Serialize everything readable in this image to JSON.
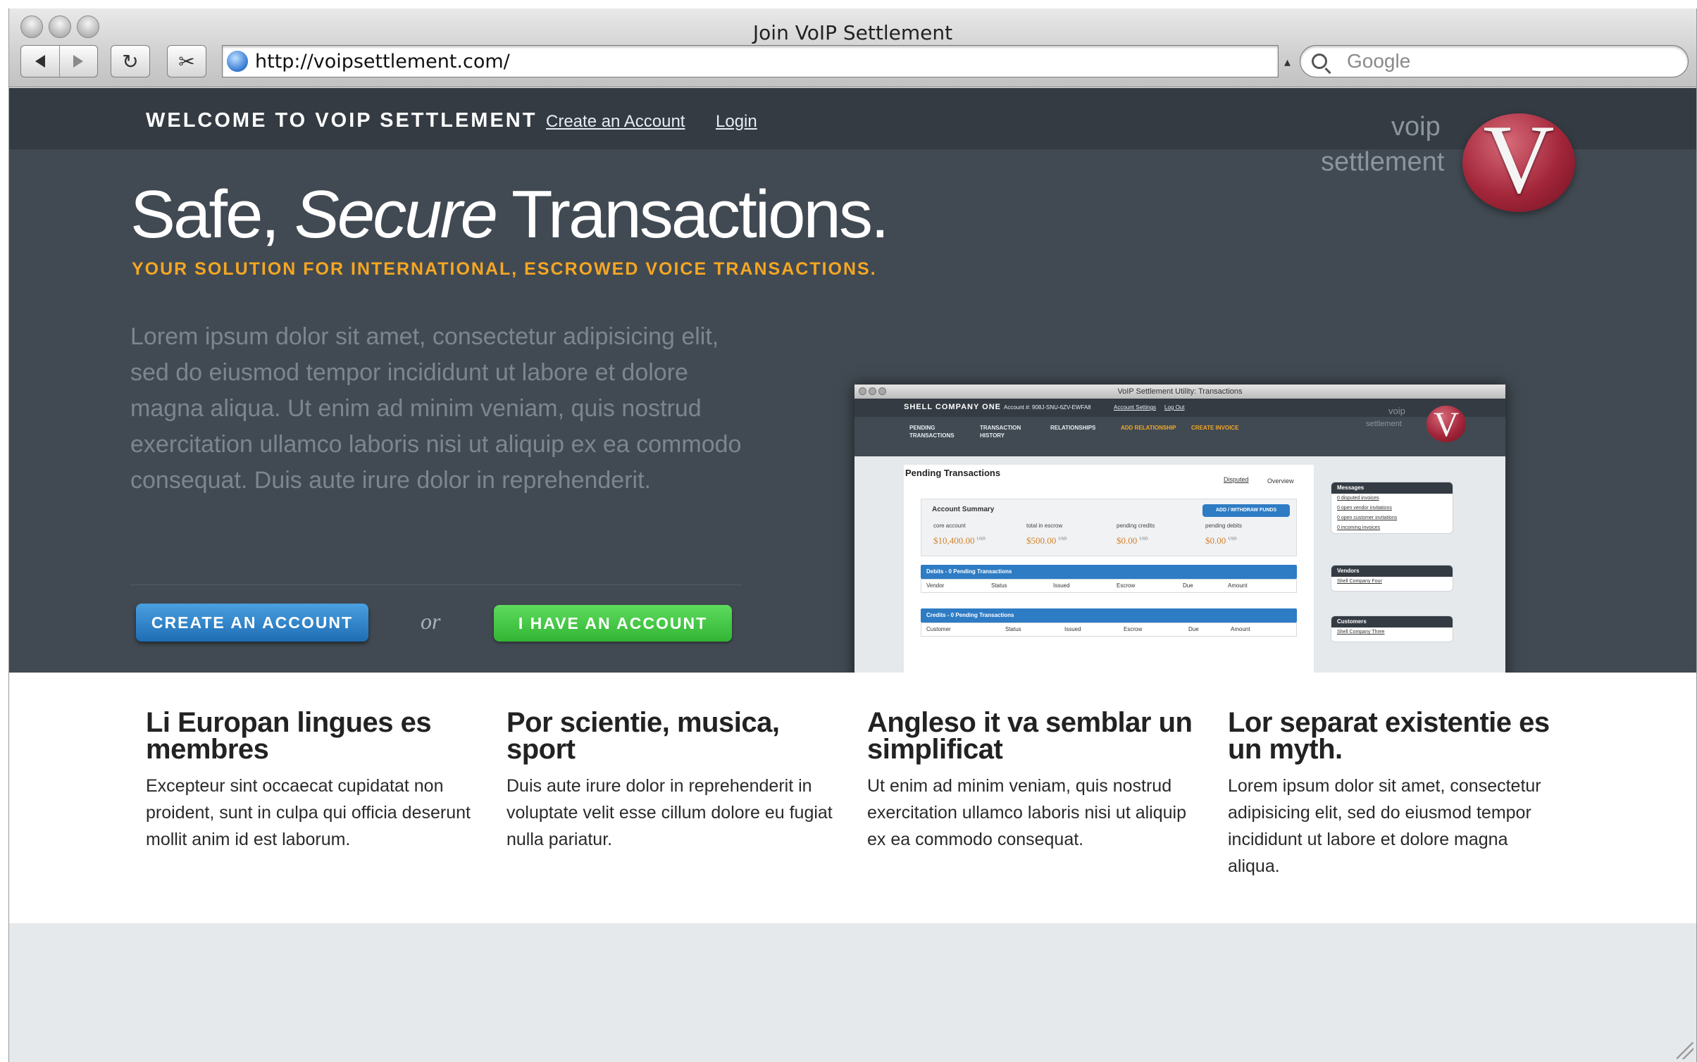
{
  "window": {
    "title": "Join VoIP Settlement"
  },
  "toolbar": {
    "url": "http://voipsettlement.com/",
    "search_placeholder": "Google",
    "reload_glyph": "↻",
    "snip_glyph": "✂"
  },
  "nav": {
    "welcome": "WELCOME TO VOIP SETTLEMENT",
    "create_account": "Create an Account",
    "login": "Login"
  },
  "logo": {
    "word1": "voip",
    "word2": "settlement",
    "letter": "V"
  },
  "hero": {
    "title_part1": "Safe, ",
    "title_italic": "Secure",
    "title_part2": " Transactions.",
    "subtitle": "YOUR SOLUTION FOR INTERNATIONAL, ESCROWED VOICE TRANSACTIONS.",
    "body": "Lorem ipsum dolor sit amet, consectetur adipisicing elit, sed do eiusmod tempor incididunt ut labore et dolore magna aliqua. Ut enim ad minim veniam, quis nostrud exercitation ullamco laboris nisi ut aliquip ex ea commodo consequat. Duis aute irure dolor in reprehenderit.",
    "btn_create": "CREATE AN ACCOUNT",
    "or": "or",
    "btn_have": "I HAVE AN ACCOUNT"
  },
  "screenshot": {
    "window_title": "VoIP Settlement Utility: Transactions",
    "company": "SHELL COMPANY ONE",
    "account": "Account #: 908J-SNU-6ZV-EWFA8",
    "account_settings": "Account Settings",
    "log_out": "Log Out",
    "tabs": [
      {
        "label": "PENDING TRANSACTIONS"
      },
      {
        "label": "TRANSACTION HISTORY"
      },
      {
        "label": "RELATIONSHIPS"
      },
      {
        "label": "ADD RELATIONSHIP"
      },
      {
        "label": "CREATE INVOICE"
      }
    ],
    "logo_word1": "voip",
    "logo_word2": "settlement",
    "logo_letter": "V",
    "heading": "Pending Transactions",
    "subtab_disputed": "Disputed",
    "subtab_overview": "Overview",
    "summary_title": "Account Summary",
    "funds_button": "ADD / WITHDRAW FUNDS",
    "summary": [
      {
        "label": "core account",
        "value": "$10,400.00",
        "unit": "USD"
      },
      {
        "label": "total in escrow",
        "value": "$500.00",
        "unit": "USD"
      },
      {
        "label": "pending credits",
        "value": "$0.00",
        "unit": "USD"
      },
      {
        "label": "pending debits",
        "value": "$0.00",
        "unit": "USD"
      }
    ],
    "debits_header": "Debits - 0 Pending Transactions",
    "debits_cols": [
      "Vendor",
      "Status",
      "Issued",
      "Escrow",
      "Due",
      "Amount"
    ],
    "credits_header": "Credits - 0 Pending Transactions",
    "credits_cols": [
      "Customer",
      "Status",
      "Issued",
      "Escrow",
      "Due",
      "Amount"
    ],
    "messages_title": "Messages",
    "messages": [
      "0 disputed invoices",
      "0 open vendor invitations",
      "0 open customer invitations",
      "0 incoming invoices"
    ],
    "vendors_title": "Vendors",
    "vendor": "Shell Company Four",
    "customers_title": "Customers",
    "customer": "Shell Company Three"
  },
  "features": [
    {
      "title": "Li Europan lingues es membres",
      "body": "Excepteur sint occaecat cupidatat non proident, sunt in culpa qui officia deserunt mollit anim id est laborum."
    },
    {
      "title": "Por scientie, musica, sport",
      "body": "Duis aute irure dolor in reprehenderit in voluptate velit esse cillum dolore eu fugiat nulla pariatur."
    },
    {
      "title": "Angleso it va semblar un simplificat",
      "body": "Ut enim ad minim veniam, quis nostrud exercitation ullamco laboris nisi ut aliquip ex ea commodo consequat."
    },
    {
      "title": "Lor separat existentie es un myth.",
      "body": "Lorem ipsum dolor sit amet, consectetur adipisicing elit, sed do eiusmod tempor incididunt ut labore et dolore magna aliqua."
    }
  ],
  "colors": {
    "nav_bg": "#343b43",
    "hero_bg": "#414a52",
    "accent_orange": "#f5a623",
    "create_blue": "#1e6db4",
    "have_green": "#33b534",
    "logo_red": "#a3263a"
  }
}
